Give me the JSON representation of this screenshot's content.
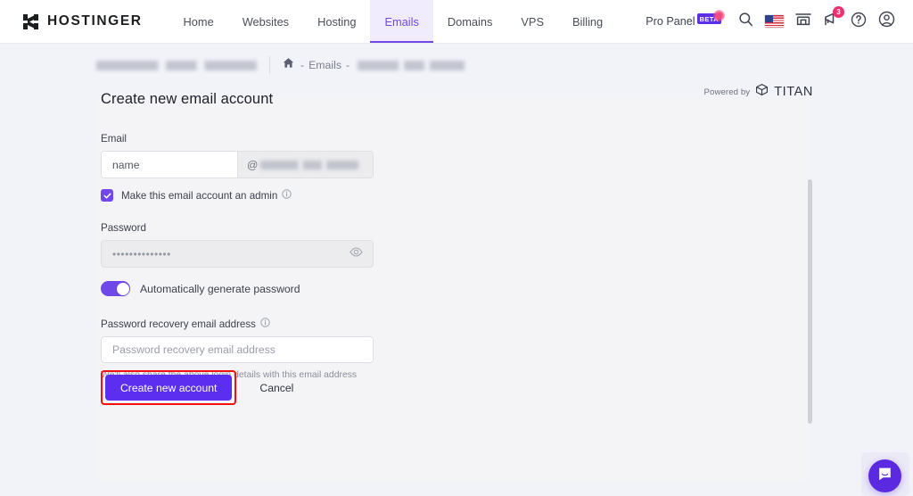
{
  "header": {
    "brand": "HOSTINGER",
    "brand_logo_icon": "hostinger-h-logo-icon",
    "nav_items": [
      {
        "label": "Home",
        "active": false
      },
      {
        "label": "Websites",
        "active": false
      },
      {
        "label": "Hosting",
        "active": false
      },
      {
        "label": "Emails",
        "active": true
      },
      {
        "label": "Domains",
        "active": false
      },
      {
        "label": "VPS",
        "active": false
      },
      {
        "label": "Billing",
        "active": false
      }
    ],
    "pro_panel_label": "Pro Panel",
    "beta_badge": "BETA",
    "icons": {
      "search": "search-icon",
      "language_flag": "us-flag-icon",
      "marketplace": "store-icon",
      "announcements": "megaphone-icon",
      "help": "help-circle-icon",
      "account": "user-circle-icon"
    },
    "notification_count": "3",
    "accent_color": "#7048e8",
    "badge_color": "#f1306b"
  },
  "breadcrumb": {
    "account_name_redacted": "",
    "home_icon": "home-icon",
    "separator_left": "-",
    "section": "Emails",
    "separator_right": "-",
    "domain_redacted": ""
  },
  "powered_by": {
    "prefix": "Powered by",
    "brand": "TITAN",
    "logo_icon": "titan-cube-icon"
  },
  "main": {
    "title": "Create new email account",
    "email": {
      "label": "Email",
      "name_value": "name",
      "at_symbol": "@",
      "domain_redacted": ""
    },
    "admin_checkbox": {
      "label": "Make this email account an admin",
      "checked": true,
      "info_icon": "info-circle-icon"
    },
    "password": {
      "label": "Password",
      "value_masked": "••••••••••••••",
      "disabled": true,
      "reveal_icon": "eye-icon"
    },
    "auto_generate_toggle": {
      "label": "Automatically generate password",
      "enabled": true
    },
    "recovery": {
      "label": "Password recovery email address",
      "info_icon": "info-circle-icon",
      "placeholder": "Password recovery email address",
      "value": "",
      "helper_text": "We'll also share the above login details with this email address"
    },
    "buttons": {
      "submit": "Create new account",
      "cancel": "Cancel",
      "submit_color": "#5c2ff0",
      "highlight_color": "#f50f0f"
    }
  },
  "chat": {
    "launcher_icon": "chat-bubble-icon",
    "color": "#5b2ae0"
  },
  "scrollbar": {
    "orientation": "vertical",
    "thumb_color": "#cfd1d8"
  }
}
